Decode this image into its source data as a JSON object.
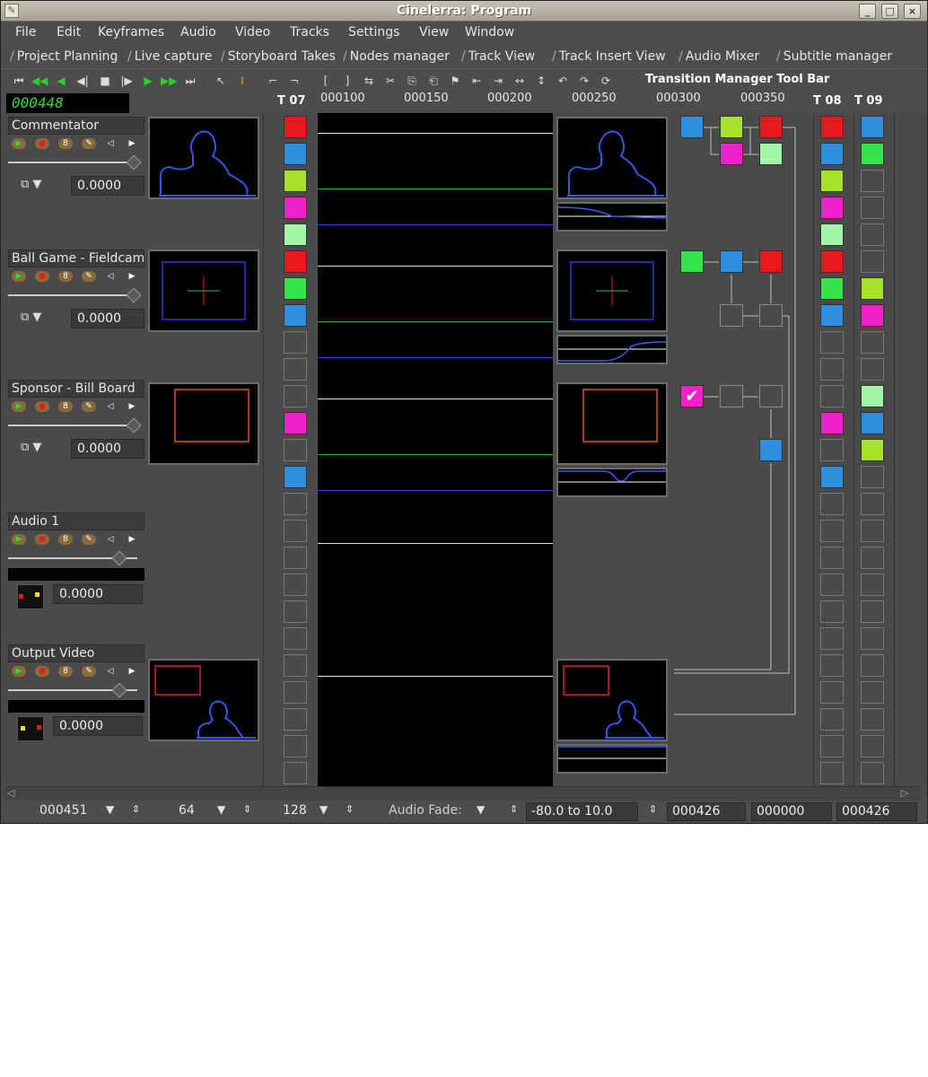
{
  "window": {
    "title": "Cinelerra: Program"
  },
  "menu": [
    "File",
    "Edit",
    "Keyframes",
    "Audio",
    "Video",
    "Tracks",
    "Settings",
    "View",
    "Window"
  ],
  "tabs": [
    "Project Planning",
    "Live capture",
    "Storyboard Takes",
    "Nodes manager",
    "Track View",
    "Track Insert View",
    "Audio Mixer",
    "Subtitle manager"
  ],
  "toolbar": {
    "transition_title": "Transition Manager Tool Bar"
  },
  "clock": "000448",
  "ruler": {
    "ticks": [
      "000100",
      "000150",
      "000200",
      "000250",
      "000300",
      "000350"
    ],
    "left_track": "T 07",
    "t08": "T 08",
    "t09": "T 09"
  },
  "tracks": [
    {
      "name": "Commentator",
      "value": "0.0000"
    },
    {
      "name": "Ball Game - Fieldcam",
      "value": "0.0000"
    },
    {
      "name": "Sponsor - Bill Board",
      "value": "0.0000"
    },
    {
      "name": "Audio 1",
      "value": "0.0000"
    },
    {
      "name": "Output Video",
      "value": "0.0000"
    }
  ],
  "colors": {
    "red": "#e8191d",
    "blue": "#2f8ede",
    "lime": "#a6e22a",
    "magenta": "#ee22c9",
    "mint": "#a3f5a8",
    "green": "#34e34a"
  },
  "status": {
    "a": "000451",
    "b": "64",
    "c": "128",
    "audio_fade": "Audio Fade:",
    "range": "-80.0 to 10.0",
    "d": "000426",
    "e": "000000",
    "f": "000426"
  }
}
